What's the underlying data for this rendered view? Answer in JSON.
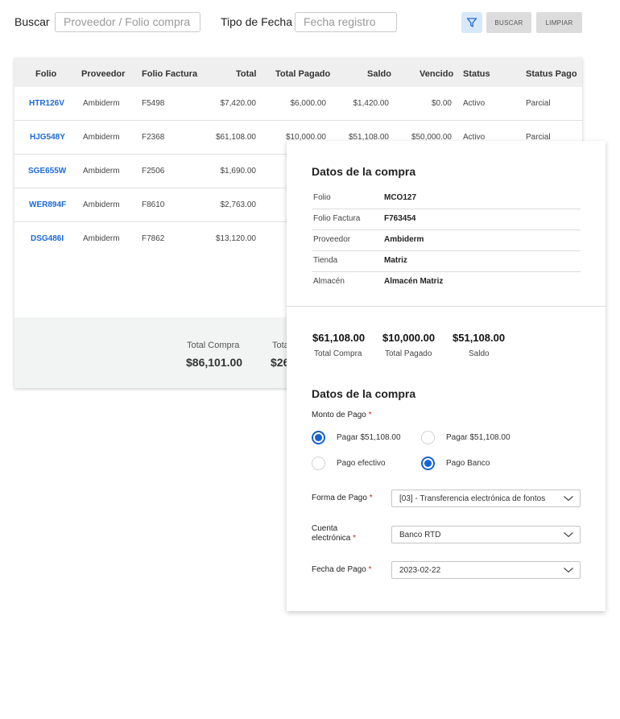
{
  "search": {
    "buscar_label": "Buscar",
    "buscar_placeholder": "Proveedor / Folio compra",
    "tipo_fecha_label": "Tipo de Fecha",
    "tipo_fecha_placeholder": "Fecha registro",
    "filter_icon": "filter-icon",
    "buscar_button": "BUSCAR",
    "limpiar_button": "LIMPIAR"
  },
  "table": {
    "headers": [
      "Folio",
      "Proveedor",
      "Folio Factura",
      "Total",
      "Total Pagado",
      "Saldo",
      "Vencido",
      "Status",
      "Status Pago"
    ],
    "rows": [
      [
        "HTR126V",
        "Ambiderm",
        "F5498",
        "$7,420.00",
        "$6,000.00",
        "$1,420.00",
        "$0.00",
        "Activo",
        "Parcial"
      ],
      [
        "HJG548Y",
        "Ambiderm",
        "F2368",
        "$61,108.00",
        "$10,000.00",
        "$51,108.00",
        "$50,000.00",
        "Activo",
        "Parcial"
      ],
      [
        "SGE655W",
        "Ambiderm",
        "F2506",
        "$1,690.00"
      ],
      [
        "WER894F",
        "Ambiderm",
        "F8610",
        "$2,763.00"
      ],
      [
        "DSG486I",
        "Ambiderm",
        "F7862",
        "$13,120.00"
      ]
    ],
    "footer": {
      "total_compra_label": "Total Compra",
      "total_compra_value": "$86,101.00",
      "total_pagado_label_partial": "Tota",
      "total_pagado_value_partial": "$26"
    }
  },
  "panel": {
    "title": "Datos de la compra",
    "info": [
      {
        "label": "Folio",
        "value": "MCO127"
      },
      {
        "label": "Folio Factura",
        "value": "F763454"
      },
      {
        "label": "Proveedor",
        "value": "Ambiderm"
      },
      {
        "label": "Tienda",
        "value": "Matriz"
      },
      {
        "label": "Almacén",
        "value": "Almacén Matriz"
      }
    ],
    "summary": [
      {
        "value": "$61,108.00",
        "label": "Total Compra"
      },
      {
        "value": "$10,000.00",
        "label": "Total Pagado"
      },
      {
        "value": "$51,108.00",
        "label": "Saldo"
      }
    ],
    "payment": {
      "title": "Datos de la compra",
      "monto_label": "Monto de Pago",
      "required_mark": "*",
      "radio_options": [
        {
          "label": "Pagar $51,108.00",
          "checked": true
        },
        {
          "label": "Pagar $51,108.00",
          "checked": false
        },
        {
          "label": "Pago efectivo",
          "checked": false
        },
        {
          "label": "Pago Banco",
          "checked": true
        }
      ],
      "forma_label": "Forma de Pago",
      "forma_value": "[03] - Transferencia electrónica de fontos",
      "cuenta_label_1": "Cuenta",
      "cuenta_label_2": "electrónica",
      "cuenta_value": "Banco RTD",
      "fecha_label": "Fecha de Pago",
      "fecha_value": "2023-02-22"
    }
  },
  "colors": {
    "link": "#1a6ad6",
    "radio_selected": "#1662d0",
    "filter_button_bg": "#d8e8fb",
    "required": "#d02020"
  }
}
